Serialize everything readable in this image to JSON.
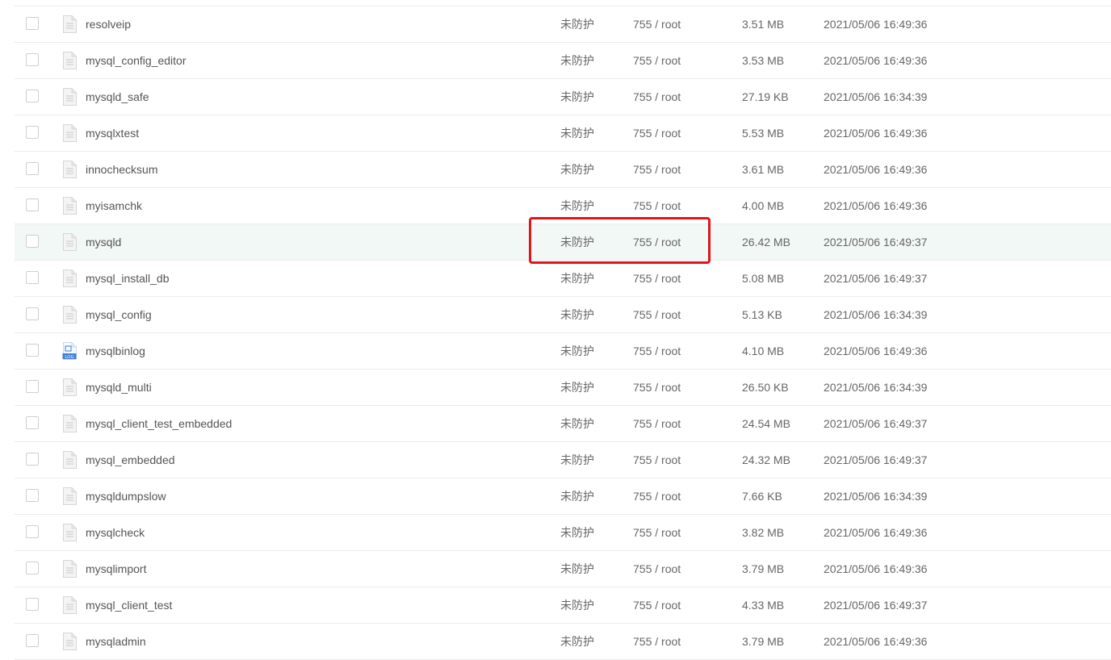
{
  "files": [
    {
      "name": "resolveip",
      "protection": "未防护",
      "permission": "755 / root",
      "size": "3.51 MB",
      "modified": "2021/05/06 16:49:36",
      "icon": "generic-file-icon"
    },
    {
      "name": "mysql_config_editor",
      "protection": "未防护",
      "permission": "755 / root",
      "size": "3.53 MB",
      "modified": "2021/05/06 16:49:36",
      "icon": "generic-file-icon"
    },
    {
      "name": "mysqld_safe",
      "protection": "未防护",
      "permission": "755 / root",
      "size": "27.19 KB",
      "modified": "2021/05/06 16:34:39",
      "icon": "generic-file-icon"
    },
    {
      "name": "mysqlxtest",
      "protection": "未防护",
      "permission": "755 / root",
      "size": "5.53 MB",
      "modified": "2021/05/06 16:49:36",
      "icon": "generic-file-icon"
    },
    {
      "name": "innochecksum",
      "protection": "未防护",
      "permission": "755 / root",
      "size": "3.61 MB",
      "modified": "2021/05/06 16:49:36",
      "icon": "generic-file-icon"
    },
    {
      "name": "myisamchk",
      "protection": "未防护",
      "permission": "755 / root",
      "size": "4.00 MB",
      "modified": "2021/05/06 16:49:36",
      "icon": "generic-file-icon"
    },
    {
      "name": "mysqld",
      "protection": "未防护",
      "permission": "755 / root",
      "size": "26.42 MB",
      "modified": "2021/05/06 16:49:37",
      "icon": "generic-file-icon",
      "highlighted": true
    },
    {
      "name": "mysql_install_db",
      "protection": "未防护",
      "permission": "755 / root",
      "size": "5.08 MB",
      "modified": "2021/05/06 16:49:37",
      "icon": "generic-file-icon"
    },
    {
      "name": "mysql_config",
      "protection": "未防护",
      "permission": "755 / root",
      "size": "5.13 KB",
      "modified": "2021/05/06 16:34:39",
      "icon": "generic-file-icon"
    },
    {
      "name": "mysqlbinlog",
      "protection": "未防护",
      "permission": "755 / root",
      "size": "4.10 MB",
      "modified": "2021/05/06 16:49:36",
      "icon": "log-file-icon",
      "icon_label": "LOG"
    },
    {
      "name": "mysqld_multi",
      "protection": "未防护",
      "permission": "755 / root",
      "size": "26.50 KB",
      "modified": "2021/05/06 16:34:39",
      "icon": "generic-file-icon"
    },
    {
      "name": "mysql_client_test_embedded",
      "protection": "未防护",
      "permission": "755 / root",
      "size": "24.54 MB",
      "modified": "2021/05/06 16:49:37",
      "icon": "generic-file-icon"
    },
    {
      "name": "mysql_embedded",
      "protection": "未防护",
      "permission": "755 / root",
      "size": "24.32 MB",
      "modified": "2021/05/06 16:49:37",
      "icon": "generic-file-icon"
    },
    {
      "name": "mysqldumpslow",
      "protection": "未防护",
      "permission": "755 / root",
      "size": "7.66 KB",
      "modified": "2021/05/06 16:34:39",
      "icon": "generic-file-icon"
    },
    {
      "name": "mysqlcheck",
      "protection": "未防护",
      "permission": "755 / root",
      "size": "3.82 MB",
      "modified": "2021/05/06 16:49:36",
      "icon": "generic-file-icon"
    },
    {
      "name": "mysqlimport",
      "protection": "未防护",
      "permission": "755 / root",
      "size": "3.79 MB",
      "modified": "2021/05/06 16:49:36",
      "icon": "generic-file-icon"
    },
    {
      "name": "mysql_client_test",
      "protection": "未防护",
      "permission": "755 / root",
      "size": "4.33 MB",
      "modified": "2021/05/06 16:49:37",
      "icon": "generic-file-icon"
    },
    {
      "name": "mysqladmin",
      "protection": "未防护",
      "permission": "755 / root",
      "size": "3.79 MB",
      "modified": "2021/05/06 16:49:36",
      "icon": "generic-file-icon"
    }
  ],
  "colors": {
    "highlight_row": "#f2f8f6",
    "annotation_border": "#e2141c",
    "log_icon_blue": "#3f7fd6"
  }
}
